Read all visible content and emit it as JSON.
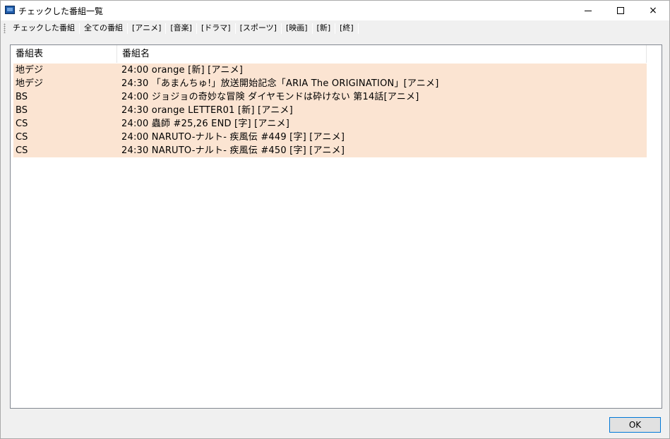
{
  "window": {
    "title": "チェックした番組一覧",
    "icon": "app-window-icon",
    "controls": {
      "minimize": "minimize-icon",
      "maximize": "maximize-icon",
      "close": "×"
    }
  },
  "toolbar": {
    "items": [
      "チェックした番組",
      "全ての番組",
      "[アニメ]",
      "[音楽]",
      "[ドラマ]",
      "[スポーツ]",
      "[映画]",
      "[新]",
      "[終]"
    ]
  },
  "list": {
    "columns": [
      "番組表",
      "番組名"
    ],
    "row_color": "#fbe4d2",
    "rows": [
      {
        "channel": "地デジ",
        "program": "24:00 orange [新] [アニメ]"
      },
      {
        "channel": "地デジ",
        "program": "24:30 「あまんちゅ!」放送開始記念「ARIA The ORIGINATION」[アニメ]"
      },
      {
        "channel": "BS",
        "program": "24:00 ジョジョの奇妙な冒険 ダイヤモンドは砕けない 第14話[アニメ]"
      },
      {
        "channel": "BS",
        "program": "24:30 orange LETTER01 [新] [アニメ]"
      },
      {
        "channel": "CS",
        "program": "24:00 蟲師 #25,26 END [字] [アニメ]"
      },
      {
        "channel": "CS",
        "program": "24:00 NARUTO-ナルト- 疾風伝 #449 [字] [アニメ]"
      },
      {
        "channel": "CS",
        "program": "24:30 NARUTO-ナルト- 疾風伝 #450 [字] [アニメ]"
      }
    ]
  },
  "footer": {
    "ok_label": "OK"
  }
}
